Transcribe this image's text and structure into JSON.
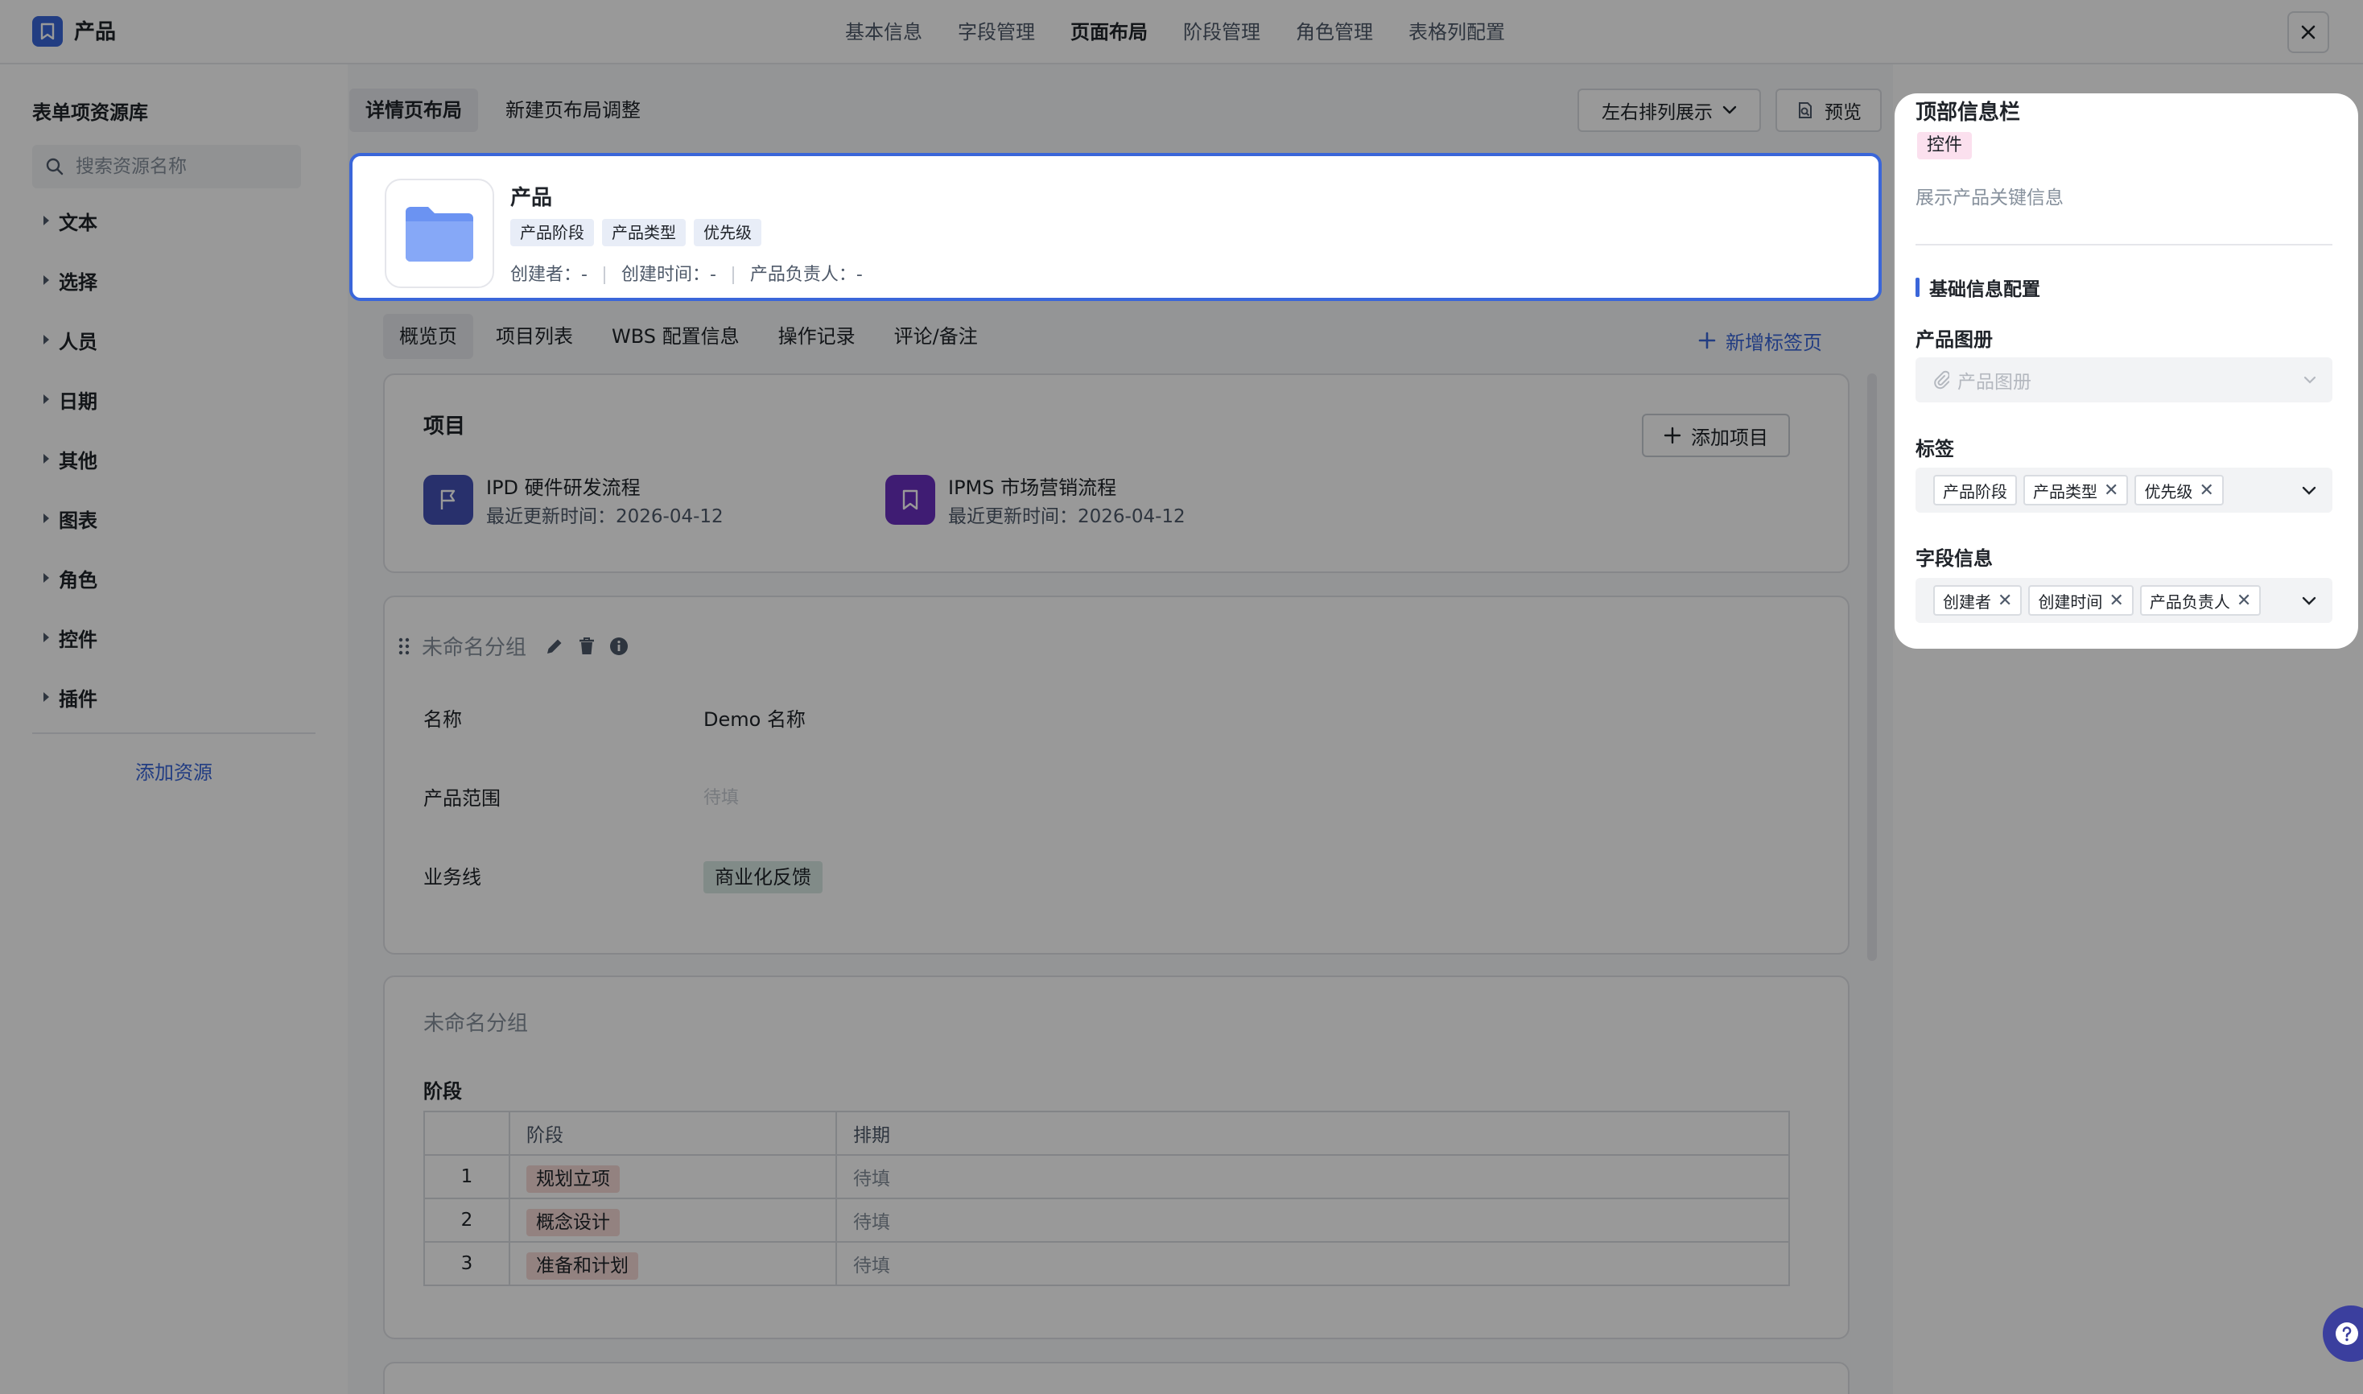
{
  "app": {
    "title": "产品"
  },
  "top_nav": {
    "items": [
      "基本信息",
      "字段管理",
      "页面布局",
      "阶段管理",
      "角色管理",
      "表格列配置"
    ],
    "active": 2
  },
  "sidebar": {
    "title": "表单项资源库",
    "search_placeholder": "搜索资源名称",
    "categories": [
      "文本",
      "选择",
      "人员",
      "日期",
      "其他",
      "图表",
      "角色",
      "控件",
      "插件"
    ],
    "add_label": "添加资源"
  },
  "layout_tabs": {
    "detail": "详情页布局",
    "new": "新建页布局调整"
  },
  "toolbar": {
    "arrange_label": "左右排列展示",
    "preview_label": "预览"
  },
  "header_card": {
    "title": "产品",
    "tags": [
      "产品阶段",
      "产品类型",
      "优先级"
    ],
    "meta": [
      "创建者：-",
      "创建时间：-",
      "产品负责人：-"
    ]
  },
  "detail_tabs": {
    "items": [
      "概览页",
      "项目列表",
      "WBS 配置信息",
      "操作记录",
      "评论/备注"
    ],
    "active": 0,
    "add_label": "新增标签页"
  },
  "projects": {
    "title": "项目",
    "add_label": "添加项目",
    "items": [
      {
        "name": "IPD 硬件研发流程",
        "updated": "最近更新时间：2026-04-12",
        "icon": "flag-icon",
        "color": "#4350b5"
      },
      {
        "name": "IPMS 市场营销流程",
        "updated": "最近更新时间：2026-04-12",
        "icon": "bookmark-icon",
        "color": "#6a2fc0"
      }
    ]
  },
  "group1": {
    "title": "未命名分组",
    "fields": [
      {
        "label": "名称",
        "value": "Demo 名称"
      },
      {
        "label": "产品范围",
        "value": "待填"
      },
      {
        "label": "业务线",
        "value": "商业化反馈"
      }
    ]
  },
  "group2": {
    "title": "未命名分组",
    "subtitle": "阶段",
    "columns": [
      "阶段",
      "排期"
    ],
    "rows": [
      {
        "idx": "1",
        "stage": "规划立项",
        "schedule": "待填"
      },
      {
        "idx": "2",
        "stage": "概念设计",
        "schedule": "待填"
      },
      {
        "idx": "3",
        "stage": "准备和计划",
        "schedule": "待填"
      }
    ]
  },
  "config_panel": {
    "title": "顶部信息栏",
    "badge": "控件",
    "description": "展示产品关键信息",
    "section": "基础信息配置",
    "album_label": "产品图册",
    "album_placeholder": "产品图册",
    "tags_label": "标签",
    "tags": [
      "产品阶段",
      "产品类型",
      "优先级"
    ],
    "fields_label": "字段信息",
    "fields": [
      "创建者",
      "创建时间",
      "产品负责人"
    ]
  },
  "colors": {
    "accent": "#3a66d9",
    "overlay": "rgba(0,0,0,0.40)",
    "badge_pink": "#fbe0ee",
    "stage_tag": "#f5d9d6",
    "bizline_tag": "#d8e8e3"
  }
}
